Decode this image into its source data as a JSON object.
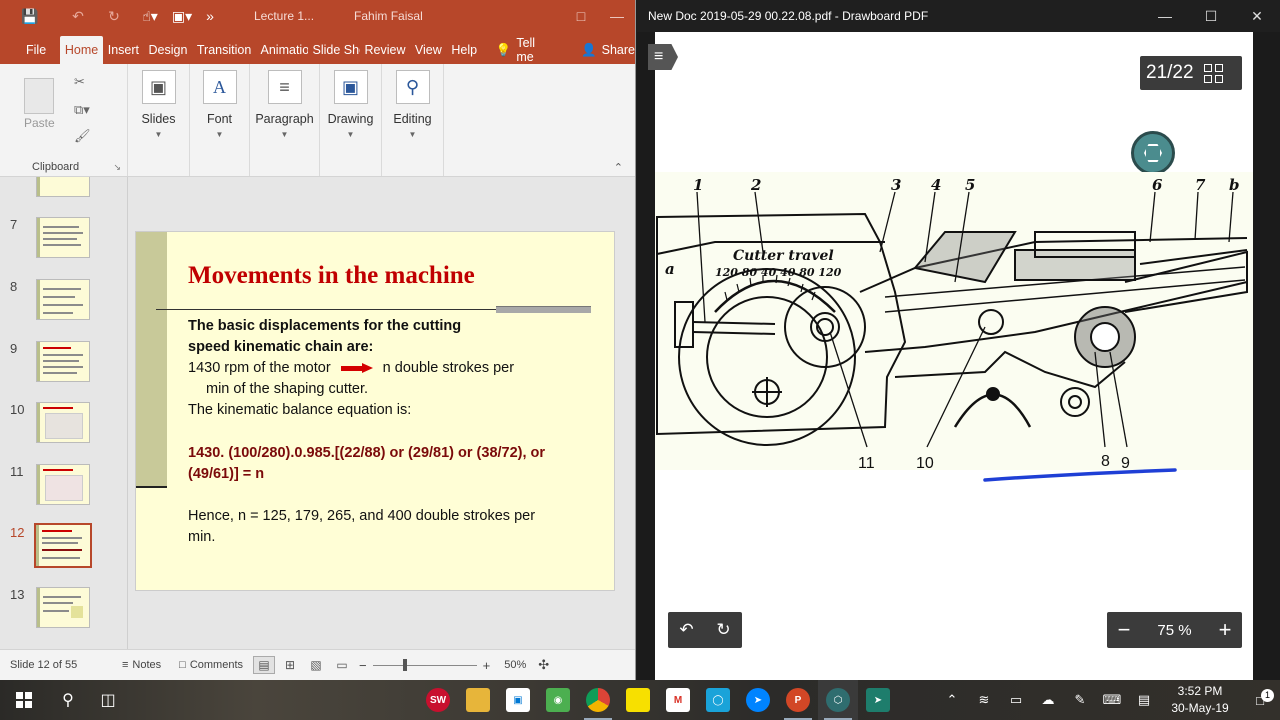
{
  "powerpoint": {
    "quick_access": {
      "doc_title": "Lecture 1...",
      "user": "Fahim Faisal"
    },
    "tabs": [
      "File",
      "Home",
      "Insert",
      "Design",
      "Transition",
      "Animatio",
      "Slide Sho",
      "Review",
      "View",
      "Help"
    ],
    "active_tab": "Home",
    "tell_me": "Tell me",
    "share": "Share",
    "ribbon": {
      "clipboard": {
        "paste": "Paste",
        "label": "Clipboard"
      },
      "groups": [
        {
          "label": "Slides",
          "icon": "slides-icon"
        },
        {
          "label": "Font",
          "icon": "font-icon"
        },
        {
          "label": "Paragraph",
          "icon": "paragraph-icon"
        },
        {
          "label": "Drawing",
          "icon": "drawing-icon"
        },
        {
          "label": "Editing",
          "icon": "search-icon"
        }
      ]
    },
    "thumbnails": [
      {
        "num": "7"
      },
      {
        "num": "8"
      },
      {
        "num": "9"
      },
      {
        "num": "10"
      },
      {
        "num": "11"
      },
      {
        "num": "12",
        "active": true
      },
      {
        "num": "13"
      }
    ],
    "slide": {
      "title": "Movements in the machine",
      "line1": "The basic displacements for the cutting",
      "line2": "speed kinematic chain are:",
      "line3a": "1430 rpm of the motor",
      "line3b": "n double strokes per",
      "line4": "min of the shaping cutter.",
      "line5": "The kinematic balance equation is:",
      "eq1": "1430. (100/280).0.985.[(22/88) or (29/81) or (38/72), or",
      "eq2": "(49/61)] = n",
      "line6": "Hence, n = 125, 179, 265, and 400 double strokes per",
      "line7": "min."
    },
    "status": {
      "slide_info": "Slide 12 of 55",
      "notes": "Notes",
      "comments": "Comments",
      "zoom": "50%"
    }
  },
  "drawboard": {
    "title": "New Doc 2019-05-29 00.22.08.pdf - Drawboard PDF",
    "page_counter": "21/22",
    "zoom": "75 %",
    "drawing_labels": {
      "top": [
        "1",
        "2",
        "3",
        "4",
        "5",
        "6",
        "7",
        "b"
      ],
      "left": "a",
      "gauge_title": "Cutter travel",
      "gauge_ticks": "120 80 40   40 80 120",
      "bottom": [
        "11",
        "10",
        "8",
        "9"
      ]
    },
    "annotation_color": "#1f3fd6"
  },
  "taskbar": {
    "time": "3:52 PM",
    "date": "30-May-19",
    "notification_count": "1",
    "apps": [
      "solidworks-icon",
      "file-explorer-icon",
      "store-icon",
      "maps-icon",
      "chrome-icon",
      "sticky-notes-icon",
      "gmail-icon",
      "outlook-icon",
      "messenger-icon",
      "powerpoint-icon",
      "drawboard-icon",
      "app-icon"
    ]
  }
}
